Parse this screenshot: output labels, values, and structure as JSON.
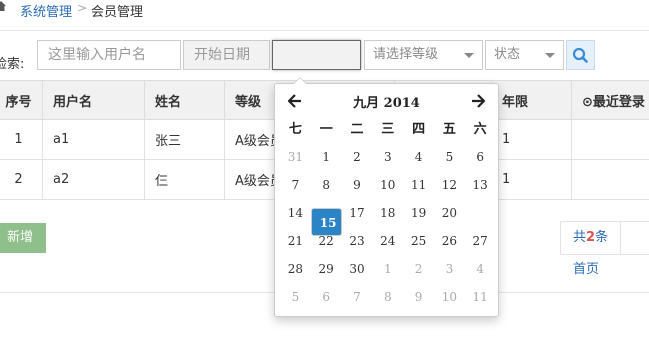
{
  "breadcrumb": {
    "item1": "系统管理",
    "separator": ">",
    "item2": "会员管理"
  },
  "search": {
    "label": "检索:",
    "username_placeholder": "这里输入用户名",
    "start_date_placeholder": "开始日期",
    "end_date_value": "",
    "level_select": "请选择等级",
    "status_select": "状态"
  },
  "table": {
    "headers": [
      "序号",
      "用户名",
      "姓名",
      "等级",
      "",
      "",
      "年限",
      "⊙最近登录"
    ],
    "rows": [
      [
        "1",
        "a1",
        "张三",
        "A级会员",
        "",
        "",
        "1",
        ""
      ],
      [
        "2",
        "a2",
        "仨",
        "A级会员",
        "",
        "",
        "1",
        ""
      ]
    ]
  },
  "actions": {
    "add_label": "新增"
  },
  "pager": {
    "total_prefix": "共",
    "total_count": "2",
    "total_suffix": "条",
    "first": "首页"
  },
  "datepicker": {
    "month_label": "九月 2014",
    "weekdays": [
      "七",
      "一",
      "二",
      "三",
      "四",
      "五",
      "六"
    ],
    "weeks": [
      [
        "31",
        "1",
        "2",
        "3",
        "4",
        "5",
        "6"
      ],
      [
        "7",
        "8",
        "9",
        "10",
        "11",
        "12",
        "13"
      ],
      [
        "14",
        "15",
        "16",
        "17",
        "18",
        "19",
        "20"
      ],
      [
        "21",
        "22",
        "23",
        "24",
        "25",
        "26",
        "27"
      ],
      [
        "28",
        "29",
        "30",
        "1",
        "2",
        "3",
        "4"
      ],
      [
        "5",
        "6",
        "7",
        "8",
        "9",
        "10",
        "11"
      ]
    ],
    "selected_day": "15",
    "prev_icon": "arrow-left-icon",
    "next_icon": "arrow-right-icon"
  },
  "colors": {
    "selected": "#2b84c6",
    "add_button": "#8fbf8a",
    "link": "#2a6cb8"
  }
}
